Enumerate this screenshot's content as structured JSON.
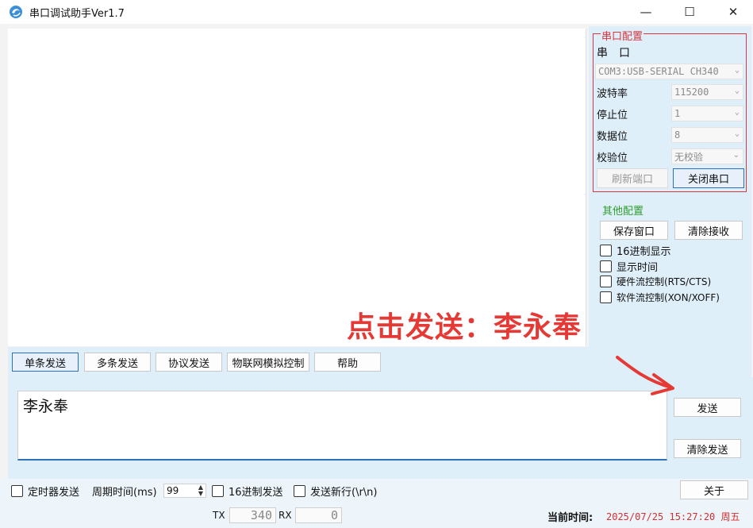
{
  "window": {
    "title": "串口调试助手Ver1.7",
    "minimize": "—",
    "maximize": "☐",
    "close": "✕"
  },
  "serial_config": {
    "group_title": "串口配置",
    "port_label": "串　口",
    "port_value": "COM3:USB-SERIAL CH340",
    "baud_label": "波特率",
    "baud_value": "115200",
    "stop_label": "停止位",
    "stop_value": "1",
    "data_label": "数据位",
    "data_value": "8",
    "parity_label": "校验位",
    "parity_value": "无校验",
    "refresh_button": "刷新端口",
    "close_port_button": "关闭串口"
  },
  "other_config": {
    "group_title": "其他配置",
    "save_window_button": "保存窗口",
    "clear_receive_button": "清除接收",
    "hex_display": "16进制显示",
    "show_time": "显示时间",
    "hw_flow": "硬件流控制(RTS/CTS)",
    "sw_flow": "软件流控制(XON/XOFF)"
  },
  "annotation": "点击发送：李永奉",
  "tabs": [
    "单条发送",
    "多条发送",
    "协议发送",
    "物联网模拟控制",
    "帮助"
  ],
  "send": {
    "text": "李永奉",
    "send_button": "发送",
    "clear_send_button": "清除发送"
  },
  "bottom": {
    "timer_send": "定时器发送",
    "period_label": "周期时间(ms)",
    "period_value": "99",
    "hex_send": "16进制发送",
    "newline_send": "发送新行(\\r\\n)",
    "about_button": "关于",
    "tx_label": "TX",
    "tx_value": "340",
    "rx_label": "RX",
    "rx_value": "0",
    "time_label": "当前时间:",
    "time_value": "2025/07/25 15:27:20 周五"
  },
  "colors": {
    "accent": "#2f6fb7",
    "serial_group_border": "#d9363e",
    "other_group_title": "#2e9e2e",
    "annotation": "#e53935",
    "time_value": "#d32f2f"
  }
}
